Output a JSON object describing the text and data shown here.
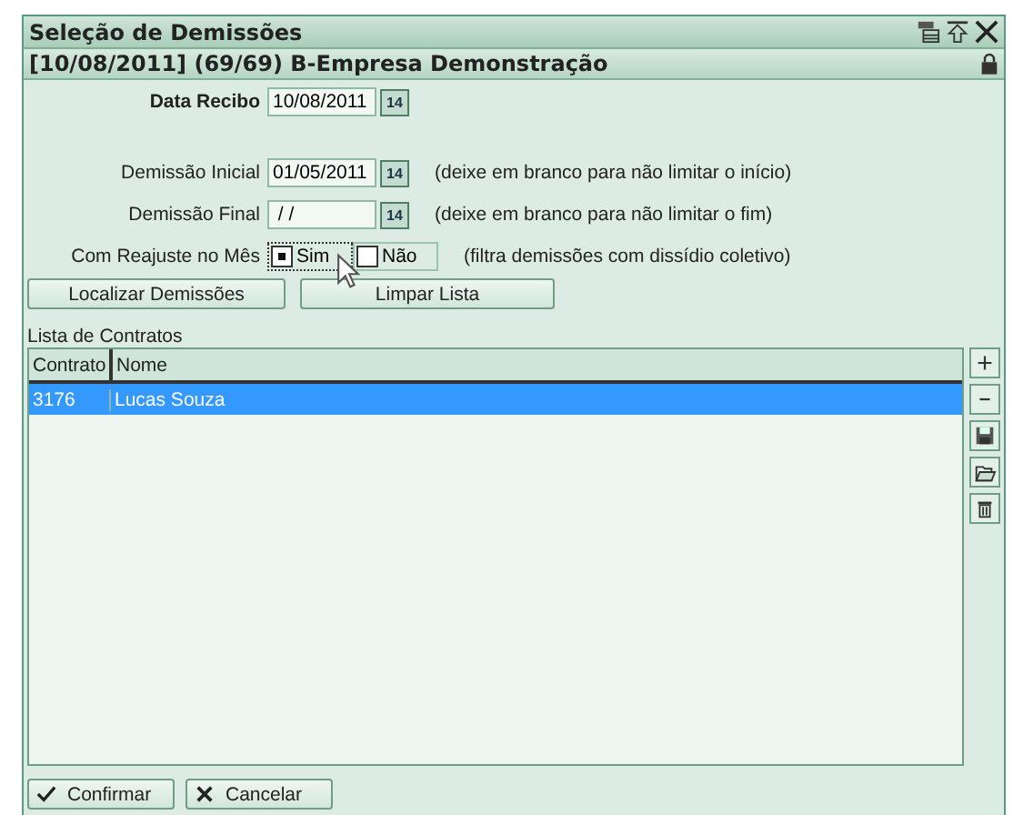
{
  "window": {
    "title": "Seleção de Demissões",
    "subtitle": "[10/08/2011] (69/69) B-Empresa Demonstração"
  },
  "fields": [
    {
      "kind": "date",
      "label": "Data Recibo",
      "value": "10/08/2011",
      "calendar": "14",
      "bold": true
    },
    {
      "kind": "spacer"
    },
    {
      "kind": "date",
      "label": "Demissão Inicial",
      "value": "01/05/2011",
      "calendar": "14",
      "hint": "(deixe em branco para não limitar o início)"
    },
    {
      "kind": "date",
      "label": "Demissão Final",
      "value": " / /",
      "calendar": "14",
      "hint": "(deixe em branco para não limitar o fim)"
    },
    {
      "kind": "radio",
      "label": "Com Reajuste no Mês",
      "options": [
        {
          "label": "Sim",
          "selected": true
        },
        {
          "label": "Não",
          "selected": false
        }
      ],
      "hint": "(filtra demissões com dissídio coletivo)"
    }
  ],
  "actions": [
    "Localizar Demissões",
    "Limpar Lista"
  ],
  "table": {
    "caption": "Lista de Contratos",
    "columns": [
      "Contrato",
      "Nome"
    ],
    "rows": [
      {
        "cells": [
          "3176",
          "Lucas Souza"
        ],
        "selected": true
      }
    ]
  },
  "side_tools": [
    {
      "kind": "plus"
    },
    {
      "kind": "minus"
    },
    {
      "kind": "save"
    },
    {
      "kind": "folder"
    },
    {
      "kind": "trash"
    }
  ],
  "footer": [
    {
      "kind": "confirm",
      "label": "Confirmar"
    },
    {
      "kind": "cancel",
      "label": "Cancelar"
    }
  ]
}
